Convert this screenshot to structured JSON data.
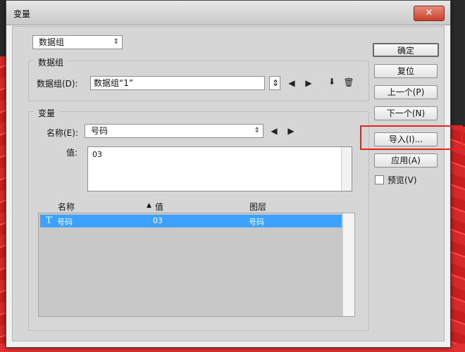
{
  "window": {
    "title": "变量",
    "close_symbol": "✕"
  },
  "top_select": {
    "value": "数据组"
  },
  "dataset_group": {
    "title": "数据组",
    "label": "数据组(D):",
    "value": "数据组“1”"
  },
  "variable_group": {
    "title": "变量",
    "name_label": "名称(E):",
    "name_value": "号码",
    "value_label": "值:",
    "value_text": "03"
  },
  "list": {
    "headers": {
      "name": "名称",
      "sort_indicator": "▲",
      "value": "值",
      "layer": "图层"
    },
    "rows": [
      {
        "type_icon": "T",
        "name": "号码",
        "value": "03",
        "layer": "号码"
      }
    ]
  },
  "buttons": {
    "ok": "确定",
    "reset": "复位",
    "prev": "上一个(P)",
    "next": "下一个(N)",
    "import": "导入(I)...",
    "apply": "应用(A)",
    "preview": "预览(V)"
  },
  "icons": {
    "prev_arrow": "◀",
    "next_arrow": "▶",
    "updown": "⇕",
    "import_dataset": "⬇",
    "delete": "🗑"
  },
  "colors": {
    "selection": "#3da2ff",
    "highlight_box": "#e5241d"
  }
}
